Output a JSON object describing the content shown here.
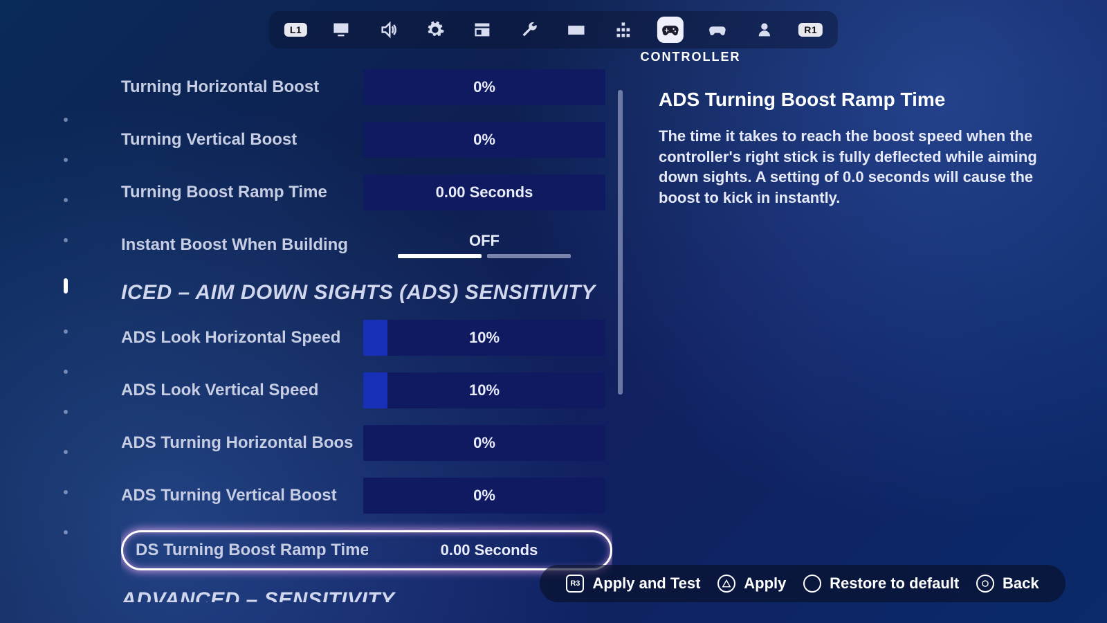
{
  "bumpers": {
    "left": "L1",
    "right": "R1"
  },
  "tabs": {
    "icons": [
      "badge",
      "display",
      "audio",
      "gear",
      "ui",
      "wrench",
      "keyboard",
      "grid",
      "controller",
      "gamepad",
      "user",
      "r1"
    ],
    "active_index": 8,
    "caption": "CONTROLLER"
  },
  "rows": [
    {
      "kind": "slider",
      "label": "Turning Horizontal Boost",
      "value": "0%",
      "fill_pct": 0
    },
    {
      "kind": "slider",
      "label": "Turning Vertical Boost",
      "value": "0%",
      "fill_pct": 0
    },
    {
      "kind": "slider",
      "label": "Turning Boost Ramp Time",
      "value": "0.00 Seconds",
      "fill_pct": 0
    },
    {
      "kind": "toggle",
      "label": "Instant Boost When Building",
      "value": "OFF",
      "state": "off"
    },
    {
      "kind": "header",
      "label": "ICED – AIM DOWN SIGHTS (ADS) SENSITIVITY"
    },
    {
      "kind": "slider",
      "label": "ADS Look Horizontal Speed",
      "value": "10%",
      "fill_pct": 10
    },
    {
      "kind": "slider",
      "label": "ADS Look Vertical Speed",
      "value": "10%",
      "fill_pct": 10
    },
    {
      "kind": "slider",
      "label": "ADS Turning Horizontal Boos",
      "value": "0%",
      "fill_pct": 0
    },
    {
      "kind": "slider",
      "label": "ADS Turning Vertical Boost",
      "value": "0%",
      "fill_pct": 0
    },
    {
      "kind": "slider",
      "label": "DS Turning Boost Ramp Time",
      "value": "0.00 Seconds",
      "fill_pct": 0,
      "selected": true
    },
    {
      "kind": "header",
      "label": "ADVANCED – SENSITIVITY"
    }
  ],
  "info": {
    "title": "ADS Turning Boost Ramp Time",
    "body": "The time it takes to reach the boost speed when the controller's right stick is fully deflected while aiming down sights.  A setting of 0.0 seconds will cause the boost to kick in instantly."
  },
  "footer": {
    "apply_test": "Apply and Test",
    "apply": "Apply",
    "restore": "Restore to default",
    "back": "Back"
  }
}
